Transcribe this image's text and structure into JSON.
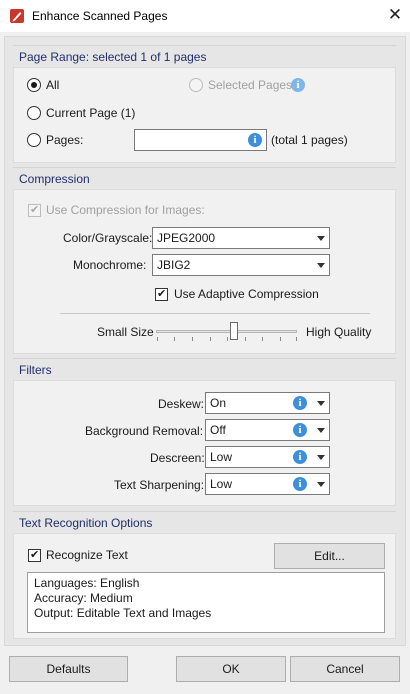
{
  "window": {
    "title": "Enhance Scanned Pages",
    "close_glyph": "✕"
  },
  "page_range": {
    "heading": "Page Range: selected 1 of 1 pages",
    "all_label": "All",
    "selected_pages_label": "Selected Pages",
    "current_page_label": "Current Page (1)",
    "pages_label": "Pages:",
    "pages_input_value": "",
    "total_label": "(total 1 pages)",
    "selected_option": "All"
  },
  "compression": {
    "heading": "Compression",
    "use_compression_label": "Use Compression for Images:",
    "use_compression_checked": true,
    "color_label": "Color/Grayscale:",
    "color_value": "JPEG2000",
    "mono_label": "Monochrome:",
    "mono_value": "JBIG2",
    "adaptive_label": "Use Adaptive Compression",
    "adaptive_checked": true,
    "small_size_label": "Small Size",
    "high_quality_label": "High Quality",
    "quality_level": 0.55
  },
  "filters": {
    "heading": "Filters",
    "deskew_label": "Deskew:",
    "deskew_value": "On",
    "background_label": "Background Removal:",
    "background_value": "Off",
    "descreen_label": "Descreen:",
    "descreen_value": "Low",
    "sharpening_label": "Text Sharpening:",
    "sharpening_value": "Low"
  },
  "ocr": {
    "heading": "Text Recognition Options",
    "recognize_label": "Recognize Text",
    "recognize_checked": true,
    "edit_label": "Edit...",
    "summary_lines": [
      "Languages: English",
      "Accuracy: Medium",
      "Output: Editable Text and Images"
    ]
  },
  "footer": {
    "defaults_label": "Defaults",
    "ok_label": "OK",
    "cancel_label": "Cancel"
  },
  "icons": {
    "info_glyph": "i",
    "check_glyph": "✔"
  },
  "colors": {
    "heading_text": "#1f2f6b",
    "info_blue": "#3d8fdc",
    "app_icon_red": "#c8372d"
  }
}
